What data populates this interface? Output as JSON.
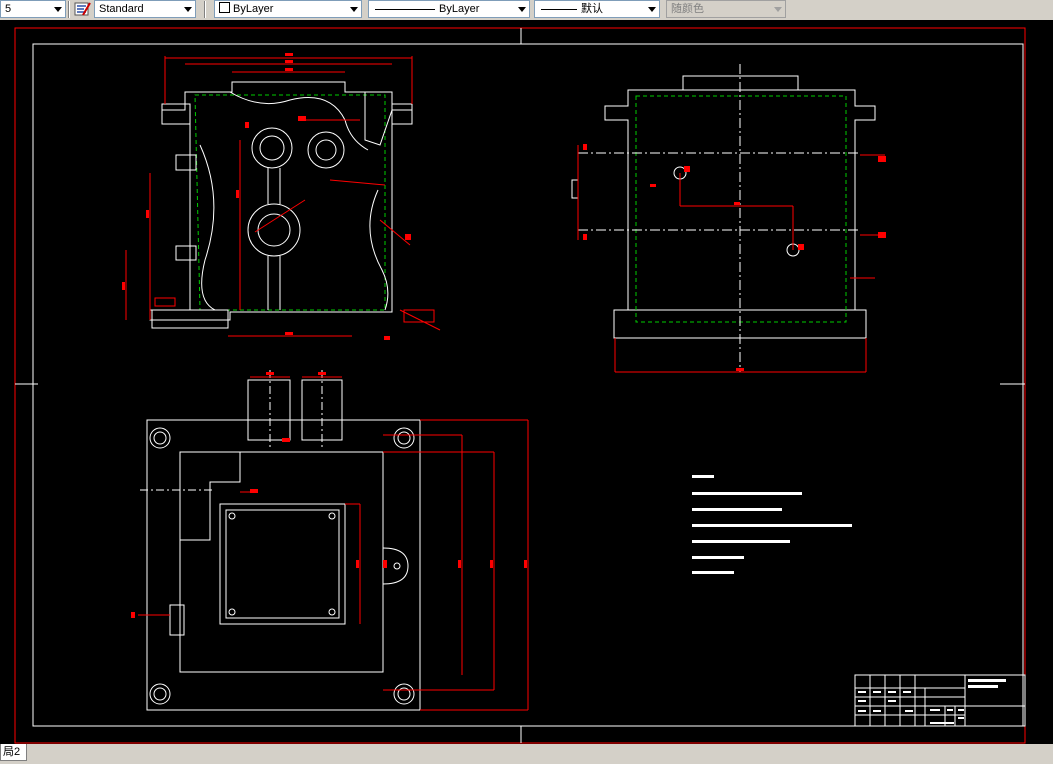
{
  "toolbar": {
    "layer_value": "5",
    "textstyle_value": "Standard",
    "color_value": "ByLayer",
    "linetype_value": "ByLayer",
    "lineweight_value": "默认",
    "plotstyle_value": "随颜色"
  },
  "tabs": {
    "layout_tab": "局2"
  },
  "colors": {
    "background": "#000000",
    "red": "#ff0000",
    "white": "#ffffff",
    "green": "#00cc00"
  }
}
